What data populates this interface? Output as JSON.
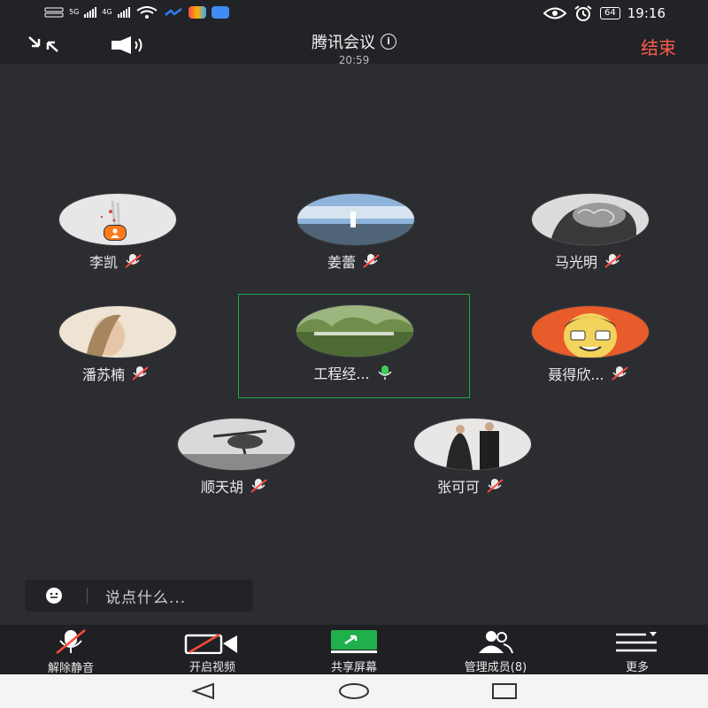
{
  "status_bar": {
    "network_label": "4G",
    "sim_signal": "5G",
    "time": "19:16",
    "battery": "64",
    "icons": [
      "sim-icon",
      "signal-icon",
      "wifi-icon",
      "app-icon",
      "app-icon",
      "app-icon",
      "eye-icon",
      "alarm-icon",
      "battery-icon"
    ]
  },
  "header": {
    "title": "腾讯会议",
    "elapsed": "20:59",
    "end_label": "结束",
    "end_color": "#ff5a4f",
    "icons": [
      "minimize-icon",
      "speaker-icon",
      "info-icon"
    ]
  },
  "participants": [
    {
      "name": "李凯",
      "mic": "muted",
      "host": true,
      "avatar_colors": [
        "#d8d8d8",
        "#e9e9e9",
        "#c94c4c"
      ]
    },
    {
      "name": "姜蕾",
      "mic": "muted",
      "host": false,
      "avatar_colors": [
        "#7aa0c8",
        "#c7d8ea",
        "#4b5e6e"
      ]
    },
    {
      "name": "马光明",
      "mic": "muted",
      "host": false,
      "avatar_colors": [
        "#6c6c6c",
        "#e0e0e0",
        "#2a2a2a"
      ]
    },
    {
      "name": "潘苏楠",
      "mic": "muted",
      "host": false,
      "avatar_colors": [
        "#e8d2b8",
        "#f3e6d6",
        "#9c7b5e"
      ]
    },
    {
      "name": "工程经...",
      "mic": "active",
      "host": false,
      "avatar_colors": [
        "#5d7d3e",
        "#a8c08a",
        "#2f3f24"
      ]
    },
    {
      "name": "聂得欣...",
      "mic": "muted",
      "host": false,
      "avatar_colors": [
        "#e85b2a",
        "#f2d35c",
        "#ffffff"
      ]
    },
    {
      "name": "顺天胡",
      "mic": "muted",
      "host": false,
      "avatar_colors": [
        "#bfbfbf",
        "#e4e4e4",
        "#3b3b3b"
      ]
    },
    {
      "name": "张可可",
      "mic": "muted",
      "host": false,
      "avatar_colors": [
        "#e8e6e6",
        "#bfb7b5",
        "#222222"
      ]
    }
  ],
  "chat": {
    "placeholder": "说点什么..."
  },
  "toolbar": {
    "unmute": "解除静音",
    "video": "开启视频",
    "share": "共享屏幕",
    "members": "管理成员(8)",
    "more": "更多",
    "share_color": "#20b04b"
  },
  "nav": {
    "icons": [
      "back-icon",
      "home-icon",
      "recents-icon"
    ]
  }
}
